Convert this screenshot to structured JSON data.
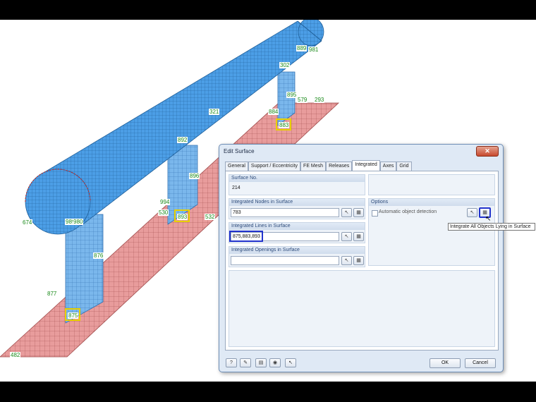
{
  "scene": {
    "node_labels": [
      "889",
      "981",
      "302",
      "895",
      "579",
      "293",
      "884",
      "883",
      "321",
      "892",
      "896",
      "994",
      "530",
      "893",
      "532",
      "674",
      "989",
      "980",
      "876",
      "877",
      "875",
      "482"
    ]
  },
  "dialog": {
    "title": "Edit Surface",
    "close": "✕",
    "tabs": [
      "General",
      "Support / Eccentricity",
      "FE Mesh",
      "Releases",
      "Integrated",
      "Axes",
      "Grid"
    ],
    "active_tab": "Integrated",
    "surface_no": {
      "label": "Surface No.",
      "value": "214"
    },
    "nodes": {
      "label": "Integrated Nodes in Surface",
      "value": "783"
    },
    "lines": {
      "label": "Integrated Lines in Surface",
      "value": "875,883,893"
    },
    "openings": {
      "label": "Integrated Openings in Surface",
      "value": ""
    },
    "options": {
      "label": "Options",
      "auto_detect": "Automatic object detection",
      "auto_detect_checked": false
    },
    "tooltip": "Integrate All Objects Lying in Surface",
    "ok": "OK",
    "cancel": "Cancel"
  },
  "colors": {
    "pipe": "#4c9ee6",
    "mesh_red": "#e89c9c",
    "highlight": "#e8d000",
    "select_blue": "#2233cc"
  }
}
